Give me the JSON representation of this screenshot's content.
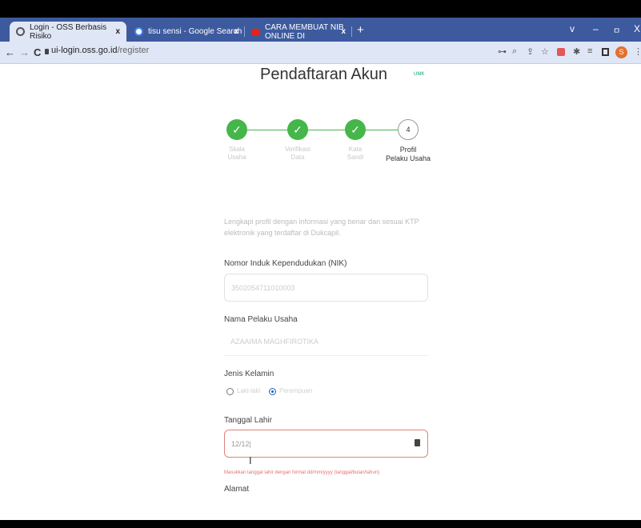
{
  "browser": {
    "tabs": [
      {
        "title": "Login - OSS Berbasis Risiko",
        "close": "x"
      },
      {
        "title": "tisu sensi - Google Search",
        "close": "x"
      },
      {
        "title": "CARA MEMBUAT NIB ONLINE DI",
        "close": "x"
      }
    ],
    "new_tab": "+",
    "window_controls": [
      "v",
      "–",
      "ㅁ",
      "X"
    ],
    "nav": {
      "back": "←",
      "forward": "→",
      "reload": "C"
    },
    "url_host": "ui-login.oss.go.id",
    "url_path": "/register",
    "profile_initial": "S",
    "accent_tab_bar": "#3d5a9e"
  },
  "page": {
    "title": "Pendaftaran Akun",
    "badge": "UMK",
    "steps": [
      {
        "mark": "✓",
        "label_line1": "Skala",
        "label_line2": "Usaha"
      },
      {
        "mark": "✓",
        "label_line1": "Verifikasi",
        "label_line2": "Data"
      },
      {
        "mark": "✓",
        "label_line1": "Kata",
        "label_line2": "Sandi"
      },
      {
        "mark": "4",
        "label_line1": "Profil",
        "label_line2": "Pelaku Usaha"
      }
    ],
    "step_color": "#45b649",
    "intro_text": "Lengkapi profil dengan informasi yang benar dan sesuai KTP elektronik yang terdaftar di Dukcapil.",
    "nik_label": "Nomor Induk Kependudukan (NIK)",
    "nik_value": "3502054711010003",
    "name_label": "Nama Pelaku Usaha",
    "name_value": "AZAAIMA MAGHFIROTIKA",
    "gender_label": "Jenis Kelamin",
    "gender_options": [
      "Laki-laki",
      "Perempuan"
    ],
    "gender_selected": "Perempuan",
    "dob_label": "Tanggal Lahir",
    "dob_value": "12/12|",
    "dob_error": "Masukkan tanggal lahir dengan format dd/mm/yyyy (tanggal/bulan/tahun)",
    "address_label": "Alamat",
    "text_cursor": "I"
  }
}
